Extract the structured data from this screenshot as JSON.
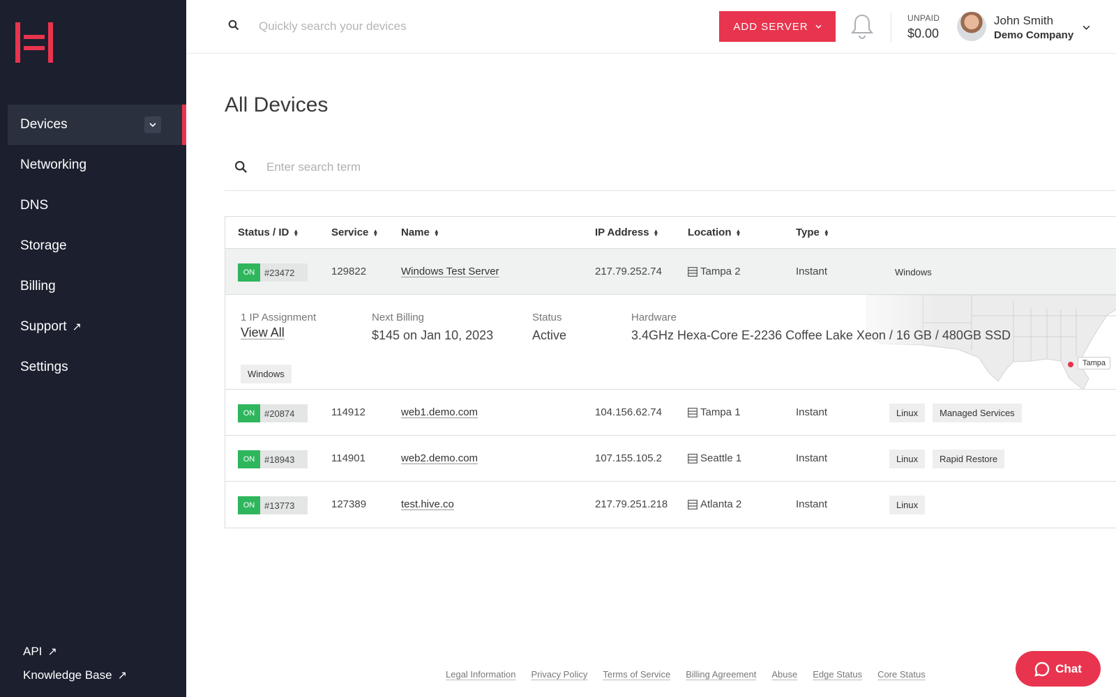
{
  "sidebar": {
    "logo_icon": "brand-logo-icon",
    "items": [
      {
        "label": "Devices",
        "active": true
      },
      {
        "label": "Networking"
      },
      {
        "label": "DNS"
      },
      {
        "label": "Storage"
      },
      {
        "label": "Billing"
      },
      {
        "label": "Support",
        "external": true
      },
      {
        "label": "Settings"
      }
    ],
    "bottom_links": [
      {
        "label": "API"
      },
      {
        "label": "Knowledge Base"
      }
    ]
  },
  "header": {
    "search_placeholder": "Quickly search your devices",
    "add_server_label": "ADD SERVER",
    "unpaid_label": "UNPAID",
    "unpaid_amount": "$0.00",
    "user_name": "John Smith",
    "user_company": "Demo Company"
  },
  "main": {
    "title": "All Devices",
    "filter_placeholder": "Enter search term",
    "columns": [
      "Status / ID",
      "Service",
      "Name",
      "IP Address",
      "Location",
      "Type"
    ],
    "rows": [
      {
        "status": "ON",
        "id": "#23472",
        "service": "129822",
        "name": "Windows Test Server",
        "ip": "217.79.252.74",
        "location": "Tampa 2",
        "type": "Instant",
        "tags": [
          "Windows"
        ],
        "selected": true
      },
      {
        "status": "ON",
        "id": "#20874",
        "service": "114912",
        "name": "web1.demo.com",
        "ip": "104.156.62.74",
        "location": "Tampa 1",
        "type": "Instant",
        "tags": [
          "Linux",
          "Managed Services"
        ]
      },
      {
        "status": "ON",
        "id": "#18943",
        "service": "114901",
        "name": "web2.demo.com",
        "ip": "107.155.105.2",
        "location": "Seattle 1",
        "type": "Instant",
        "tags": [
          "Linux",
          "Rapid Restore"
        ]
      },
      {
        "status": "ON",
        "id": "#13773",
        "service": "127389",
        "name": "test.hive.co",
        "ip": "217.79.251.218",
        "location": "Atlanta 2",
        "type": "Instant",
        "tags": [
          "Linux"
        ]
      }
    ],
    "detail": {
      "ip_label": "1 IP Assignment",
      "ip_link": "View All",
      "billing_label": "Next Billing",
      "billing_value": "$145 on Jan 10, 2023",
      "status_label": "Status",
      "status_value": "Active",
      "hardware_label": "Hardware",
      "hardware_value": "3.4GHz Hexa-Core E-2236 Coffee Lake Xeon / 16 GB / 480GB SSD",
      "tag": "Windows",
      "map_marker": "Tampa"
    }
  },
  "footer": {
    "links": [
      "Legal Information",
      "Privacy Policy",
      "Terms of Service",
      "Billing Agreement",
      "Abuse",
      "Edge Status",
      "Core Status"
    ]
  },
  "chat": {
    "label": "Chat"
  },
  "colors": {
    "accent": "#e8344e",
    "sidebar": "#1b1f2e",
    "on": "#2fb65d"
  }
}
